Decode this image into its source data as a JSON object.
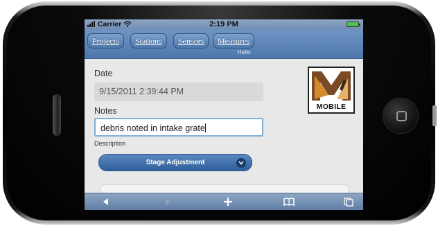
{
  "statusbar": {
    "carrier": "Carrier",
    "time": "2:19 PM"
  },
  "nav": {
    "projects": "Projects",
    "stations": "Stations",
    "sensors": "Sensors",
    "measures": "Measures",
    "subtitle": "Hello"
  },
  "form": {
    "date_label": "Date",
    "date_value": "9/15/2011 2:39:44 PM",
    "notes_label": "Notes",
    "notes_value": "debris noted in intake grate",
    "description_label": "Description",
    "description_selected": "Stage Adjustment"
  },
  "logo": {
    "text": "MOBILE"
  },
  "toolbar": {
    "icons": [
      "back-arrow-icon",
      "forward-arrow-icon",
      "plus-icon",
      "bookmarks-icon",
      "pages-icon"
    ]
  },
  "colors": {
    "nav_blue": "#4d77ab",
    "select_blue": "#2f5f9b",
    "logo_brown": "#7a4a24",
    "logo_orange": "#d48a2a"
  }
}
